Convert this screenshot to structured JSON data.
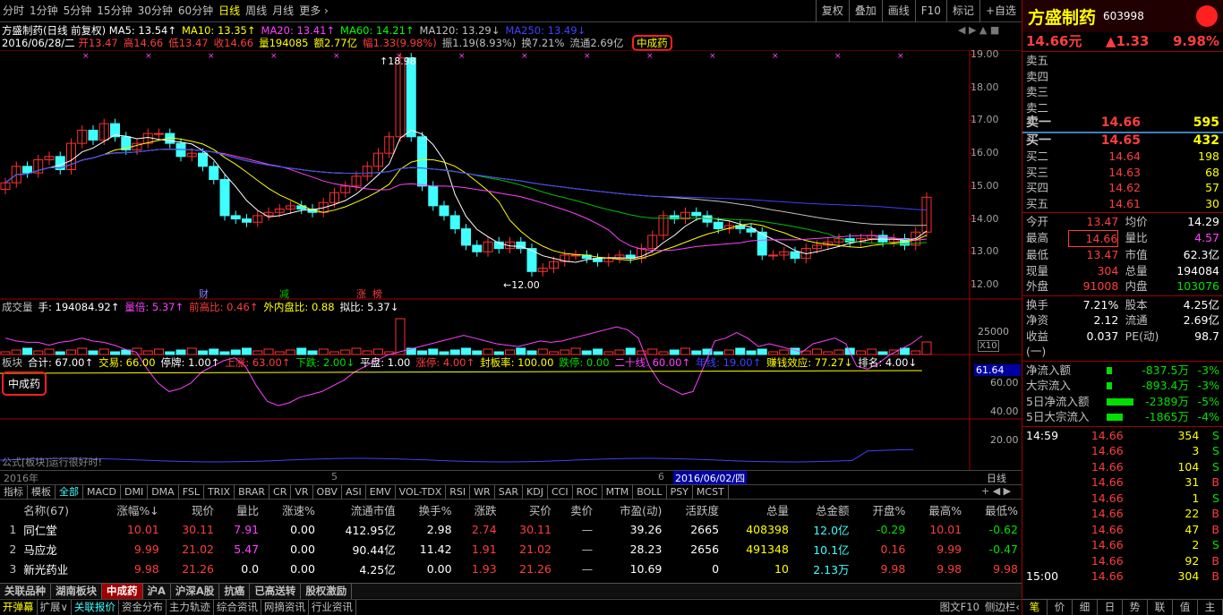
{
  "toolbar": {
    "periods": [
      "分时",
      "1分钟",
      "5分钟",
      "15分钟",
      "30分钟",
      "60分钟",
      "日线",
      "周线",
      "月线",
      "更多 ›"
    ],
    "actions": [
      "复权",
      "叠加",
      "画线",
      "F10",
      "标记",
      "+自选"
    ],
    "win_icons": "◀ ▶ ▲ ■"
  },
  "chart": {
    "title": "方盛制药(日线 前复权)",
    "ma": [
      {
        "t": "MA5: 13.54↑",
        "c": "#ffffff"
      },
      {
        "t": "MA10: 13.35↑",
        "c": "#ffff00"
      },
      {
        "t": "MA20: 13.41↑",
        "c": "#ff40ff"
      },
      {
        "t": "MA60: 14.21↑",
        "c": "#00ff00"
      },
      {
        "t": "MA120: 13.29↓",
        "c": "#c0c0c0"
      },
      {
        "t": "MA250: 13.49↓",
        "c": "#4040ff"
      }
    ],
    "info_date": "2016/06/28/二",
    "info": [
      {
        "t": "开13.47",
        "c": "#ff3d3d"
      },
      {
        "t": "高14.66",
        "c": "#ff3d3d"
      },
      {
        "t": "低13.47",
        "c": "#ff3d3d"
      },
      {
        "t": "收14.66",
        "c": "#ff3d3d"
      },
      {
        "t": "量194085",
        "c": "#ffff00"
      },
      {
        "t": "额2.77亿",
        "c": "#ffff00"
      },
      {
        "t": "幅1.33(9.98%)",
        "c": "#ff3d3d"
      },
      {
        "t": "振1.19(8.93%)",
        "c": "#c0c0c0"
      },
      {
        "t": "换7.21%",
        "c": "#c0c0c0"
      },
      {
        "t": "流通2.69亿",
        "c": "#c0c0c0"
      }
    ],
    "sector_tag": "中成药",
    "high_label": "18.98",
    "low_label": "12.00",
    "yaxis": [
      "19.00",
      "18.00",
      "17.00",
      "16.00",
      "15.00",
      "14.00",
      "13.00",
      "12.00"
    ],
    "events": [
      {
        "t": "财",
        "c": "#8080ff"
      },
      {
        "t": "减",
        "c": "#00c000"
      },
      {
        "t": "涨",
        "c": "#ff3d3d"
      },
      {
        "t": "榜",
        "c": "#ff3d3d"
      }
    ],
    "x_labels": [
      "2016年",
      "5",
      "6"
    ],
    "cursor_date": "2016/06/02/四",
    "period_btn": "日线"
  },
  "volume": {
    "items": [
      {
        "t": "成交量",
        "c": "#c0c0c0"
      },
      {
        "t": "手: 194084.92↑",
        "c": "#ffffff"
      },
      {
        "t": "量倍: 5.37↑",
        "c": "#ff40ff"
      },
      {
        "t": "前高比: 0.46↑",
        "c": "#ff3d3d"
      },
      {
        "t": "外内盘比: 0.88",
        "c": "#ffff00"
      },
      {
        "t": "拟比: 5.37↓",
        "c": "#ffffff"
      }
    ],
    "yaxis": [
      "25000"
    ],
    "unit": "X10"
  },
  "indicator": {
    "items": [
      {
        "t": "板块",
        "c": "#c0c0c0"
      },
      {
        "t": "合计: 67.00↑",
        "c": "#ffffff"
      },
      {
        "t": "交易: 66.00",
        "c": "#ffff00"
      },
      {
        "t": "停牌: 1.00↑",
        "c": "#ffffff"
      },
      {
        "t": "上涨: 63.00↑",
        "c": "#ff3d3d"
      },
      {
        "t": "下跌: 2.00↓",
        "c": "#00e000"
      },
      {
        "t": "平盘: 1.00",
        "c": "#ffffff"
      },
      {
        "t": "涨停: 4.00↑",
        "c": "#ff3d3d"
      },
      {
        "t": "封板率: 100.00",
        "c": "#ffff00"
      },
      {
        "t": "跌停: 0.00",
        "c": "#00e000"
      },
      {
        "t": "二十线: 60.00↑",
        "c": "#ff40ff"
      },
      {
        "t": "年线: 19.00↑",
        "c": "#4040ff"
      },
      {
        "t": "赚钱效应: 77.27↓",
        "c": "#ffff00"
      },
      {
        "t": "排名: 4.00↓",
        "c": "#ffffff"
      }
    ],
    "tag": "中成药",
    "formula_note": "公式[板块]运行很好时!",
    "value_box": "61.64",
    "yaxis": [
      "60.00",
      "40.00",
      "20.00"
    ]
  },
  "index_tabs": [
    "指标",
    "模板",
    "全部",
    "MACD",
    "DMI",
    "DMA",
    "FSL",
    "TRIX",
    "BRAR",
    "CR",
    "VR",
    "OBV",
    "ASI",
    "EMV",
    "VOL-TDX",
    "RSI",
    "WR",
    "SAR",
    "KDJ",
    "CCI",
    "ROC",
    "MTM",
    "BOLL",
    "PSY",
    "MCST"
  ],
  "table": {
    "headers": [
      "",
      "名称(67)",
      "涨幅%↓",
      "现价",
      "量比",
      "涨速%",
      "流通市值",
      "换手%",
      "涨跌",
      "买价",
      "卖价",
      "市盈(动)",
      "活跃度",
      "总量",
      "总金额",
      "开盘%",
      "最高%",
      "最低%"
    ],
    "rows": [
      [
        "1",
        "同仁堂",
        "10.01",
        "30.11",
        "7.91",
        "0.00",
        "412.95亿",
        "2.98",
        "2.74",
        "30.11",
        "—",
        "39.26",
        "2665",
        "408398",
        "12.0亿",
        "-0.29",
        "10.01",
        "-0.62"
      ],
      [
        "2",
        "马应龙",
        "9.99",
        "21.02",
        "5.47",
        "0.00",
        "90.44亿",
        "11.42",
        "1.91",
        "21.02",
        "—",
        "28.23",
        "2656",
        "491348",
        "10.1亿",
        "0.16",
        "9.99",
        "-0.47"
      ],
      [
        "3",
        "新光药业",
        "9.98",
        "21.26",
        "0.0",
        "0.00",
        "4.25亿",
        "0.00",
        "1.93",
        "21.26",
        "—",
        "10.69",
        "0",
        "10",
        "2.13万",
        "9.98",
        "9.98",
        "9.98"
      ]
    ]
  },
  "bottom_tabs": [
    "关联品种",
    "湖南板块",
    "中成药",
    "沪A",
    "沪深A股",
    "抗癌",
    "已高送转",
    "股权激励"
  ],
  "status_tabs": [
    "开弹幕",
    "扩展∨",
    "关联报价",
    "资金分布",
    "主力轨迹",
    "综合资讯",
    "网摘资讯",
    "行业资讯"
  ],
  "status_right": [
    "图文F10",
    "侧边栏‹"
  ],
  "right": {
    "name": "方盛制药",
    "code": "603998",
    "price": "14.66元",
    "change": "▲1.33",
    "pct": "9.98%",
    "sell": [
      {
        "l": "卖五",
        "p": "",
        "v": ""
      },
      {
        "l": "卖四",
        "p": "",
        "v": ""
      },
      {
        "l": "卖三",
        "p": "",
        "v": ""
      },
      {
        "l": "卖二",
        "p": "",
        "v": ""
      },
      {
        "l": "卖一",
        "p": "14.66",
        "v": "595"
      }
    ],
    "buy": [
      {
        "l": "买一",
        "p": "14.65",
        "v": "432"
      },
      {
        "l": "买二",
        "p": "14.64",
        "v": "198"
      },
      {
        "l": "买三",
        "p": "14.63",
        "v": "68"
      },
      {
        "l": "买四",
        "p": "14.62",
        "v": "57"
      },
      {
        "l": "买五",
        "p": "14.61",
        "v": "30"
      }
    ],
    "stats": [
      [
        "今开",
        "13.47",
        "均价",
        "14.29"
      ],
      [
        "最高",
        "14.66",
        "量比",
        "4.57"
      ],
      [
        "最低",
        "13.47",
        "市值",
        "62.3亿"
      ],
      [
        "现量",
        "304",
        "总量",
        "194084"
      ],
      [
        "外盘",
        "91008",
        "内盘",
        "103076"
      ]
    ],
    "stats2": [
      [
        "换手",
        "7.21%",
        "股本",
        "4.25亿"
      ],
      [
        "净资",
        "2.12",
        "流通",
        "2.69亿"
      ],
      [
        "收益(一)",
        "0.037",
        "PE(动)",
        "98.7"
      ]
    ],
    "flows": [
      [
        "净流入额",
        "-837.5万",
        "-3%"
      ],
      [
        "大宗流入",
        "-893.4万",
        "-3%"
      ],
      [
        "5日净流入额",
        "-2389万",
        "-5%"
      ],
      [
        "5日大宗流入",
        "-1865万",
        "-4%"
      ]
    ],
    "ticks": [
      [
        "14:59",
        "14.66",
        "354",
        "S"
      ],
      [
        "",
        "14.66",
        "3",
        "S"
      ],
      [
        "",
        "14.66",
        "104",
        "S"
      ],
      [
        "",
        "14.66",
        "31",
        "B"
      ],
      [
        "",
        "14.66",
        "1",
        "S"
      ],
      [
        "",
        "14.66",
        "22",
        "B"
      ],
      [
        "",
        "14.66",
        "47",
        "B"
      ],
      [
        "",
        "14.66",
        "2",
        "S"
      ],
      [
        "",
        "14.66",
        "92",
        "B"
      ],
      [
        "15:00",
        "14.66",
        "304",
        "B"
      ]
    ],
    "bottom": [
      "笔",
      "价",
      "细",
      "日",
      "势",
      "联",
      "值",
      "主"
    ]
  }
}
